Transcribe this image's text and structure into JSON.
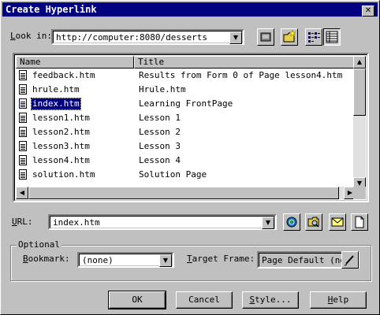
{
  "window": {
    "title": "Create Hyperlink",
    "close_glyph": "✕"
  },
  "look_in": {
    "label_before": "",
    "label_u": "L",
    "label_after": "ook in:",
    "value": "http://computer:8080/desserts"
  },
  "toolbar": {
    "icons": [
      "web-browse-icon",
      "new-folder-icon",
      "list-view-icon",
      "details-view-icon"
    ]
  },
  "list": {
    "columns": [
      "Name",
      "Title"
    ],
    "rows": [
      {
        "name": "feedback.htm",
        "title": "Results from Form 0 of Page lesson4.htm"
      },
      {
        "name": "hrule.htm",
        "title": "Hrule.htm"
      },
      {
        "name": "index.htm",
        "title": "Learning FrontPage"
      },
      {
        "name": "lesson1.htm",
        "title": "Lesson 1"
      },
      {
        "name": "lesson2.htm",
        "title": "Lesson 2"
      },
      {
        "name": "lesson3.htm",
        "title": "Lesson 3"
      },
      {
        "name": "lesson4.htm",
        "title": "Lesson 4"
      },
      {
        "name": "solution.htm",
        "title": "Solution Page"
      }
    ],
    "selected_index": 2
  },
  "url": {
    "label_u": "U",
    "label_after": "RL:",
    "value": "index.htm",
    "icons": [
      "browse-web-icon",
      "browse-file-icon",
      "email-icon",
      "new-page-icon"
    ]
  },
  "optional": {
    "group_label": "Optional",
    "bookmark_label_u": "B",
    "bookmark_label_after": "ookmark:",
    "bookmark_value": "(none)",
    "target_label_u": "T",
    "target_label_after": "arget Frame:",
    "target_value": "Page Default (non"
  },
  "buttons": {
    "ok": "OK",
    "cancel": "Cancel",
    "style_u": "S",
    "style_after": "tyle...",
    "help_u": "H",
    "help_after": "elp"
  },
  "colors": {
    "selection": "#000080",
    "titlebar": "#000080",
    "face": "#c0c0c0"
  }
}
